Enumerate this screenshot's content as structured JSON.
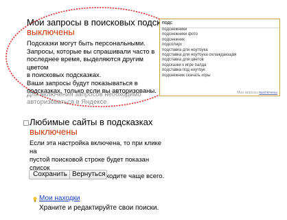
{
  "section1": {
    "title": "Мои запросы в поисковых подсказках",
    "status": "выключены",
    "description": [
      "Подсказки могут быть персональными.",
      "Запросы, которые вы спрашивали часто в",
      "последнее время, выделяются другим цветом",
      "в поисковых подсказках.",
      "Ваши запросы будут показываться в",
      "подсказках, только если вы авторизованы."
    ],
    "note": [
      "Для включения запросов необходимо",
      "авторизоваться в Яндексе."
    ]
  },
  "suggest": {
    "query": "подс",
    "items": [
      "подснежники",
      "подснежники фото",
      "подснежник",
      "подсолнух",
      "подставка для ноутбука",
      "подставка для ноутбука охлаждающая",
      "подставка для цветов",
      "подсказки к игре балда",
      "подставка под ноутбук",
      "подснежник скачать игры"
    ],
    "footer_text": "Мои запросы",
    "footer_link": "выключены"
  },
  "section2": {
    "title": "Любимые сайты в подсказках",
    "status": "выключены",
    "description": [
      "Если эта настройка включена, то при клике на",
      "пустой поисковой строке будет показан список",
      "сайтов, на которые вы заходите чаще всего."
    ],
    "save_label": "Сохранить",
    "back_label": "Вернуться"
  },
  "section3": {
    "link": "Мои находки",
    "description": "Храните и редактируйте свои поиски."
  },
  "colors": {
    "status_red": "#cc3300",
    "circle_red": "#e03030",
    "link_blue": "#1a3dc1",
    "suggest_border": "#c9a640"
  }
}
